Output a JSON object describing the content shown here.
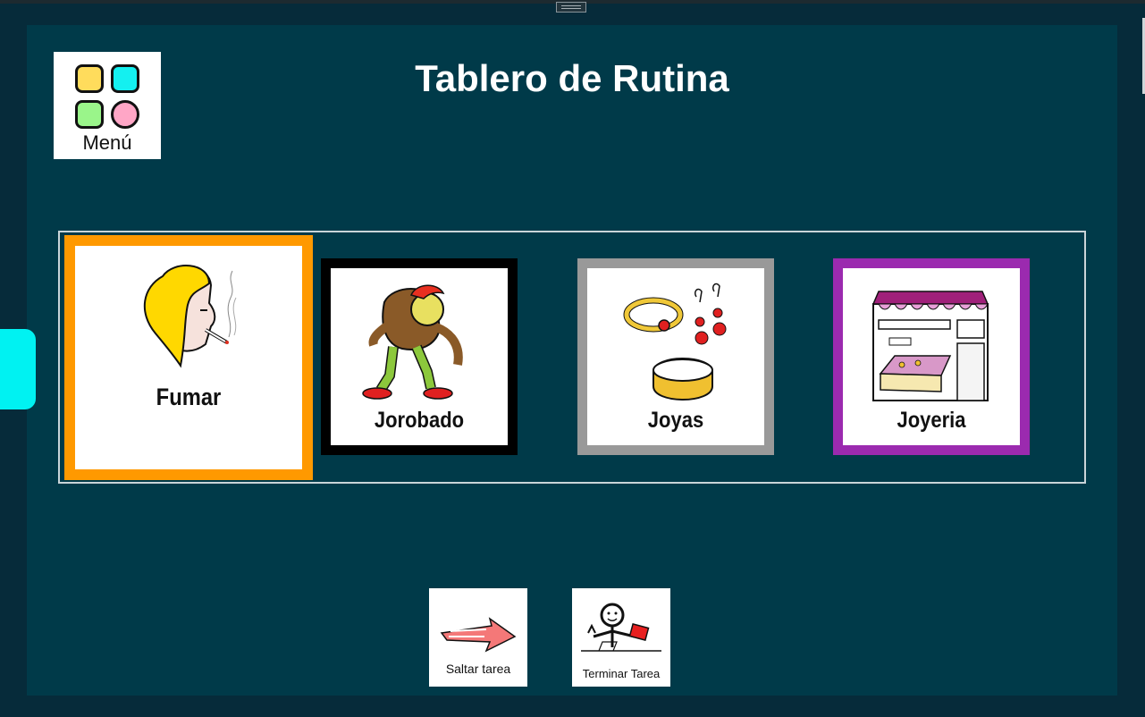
{
  "header": {
    "title": "Tablero de Rutina"
  },
  "menu": {
    "label": "Menú",
    "icon": "app-grid-icon"
  },
  "tasks": [
    {
      "label": "Fumar",
      "icon": "smoking-person-icon",
      "border_color": "#ff9900",
      "selected": true
    },
    {
      "label": "Jorobado",
      "icon": "hunchback-icon",
      "border_color": "#000000",
      "selected": false
    },
    {
      "label": "Joyas",
      "icon": "jewelry-icon",
      "border_color": "#999999",
      "selected": false
    },
    {
      "label": "Joyeria",
      "icon": "jewelry-store-icon",
      "border_color": "#9b2aaf",
      "selected": false
    }
  ],
  "actions": {
    "skip": {
      "label": "Saltar tarea",
      "icon": "arrow-right-icon"
    },
    "finish": {
      "label": "Terminar Tarea",
      "icon": "finish-task-icon"
    }
  },
  "colors": {
    "background": "#003a49",
    "side_tab": "#00f2f2",
    "accent_orange": "#ff9900"
  }
}
